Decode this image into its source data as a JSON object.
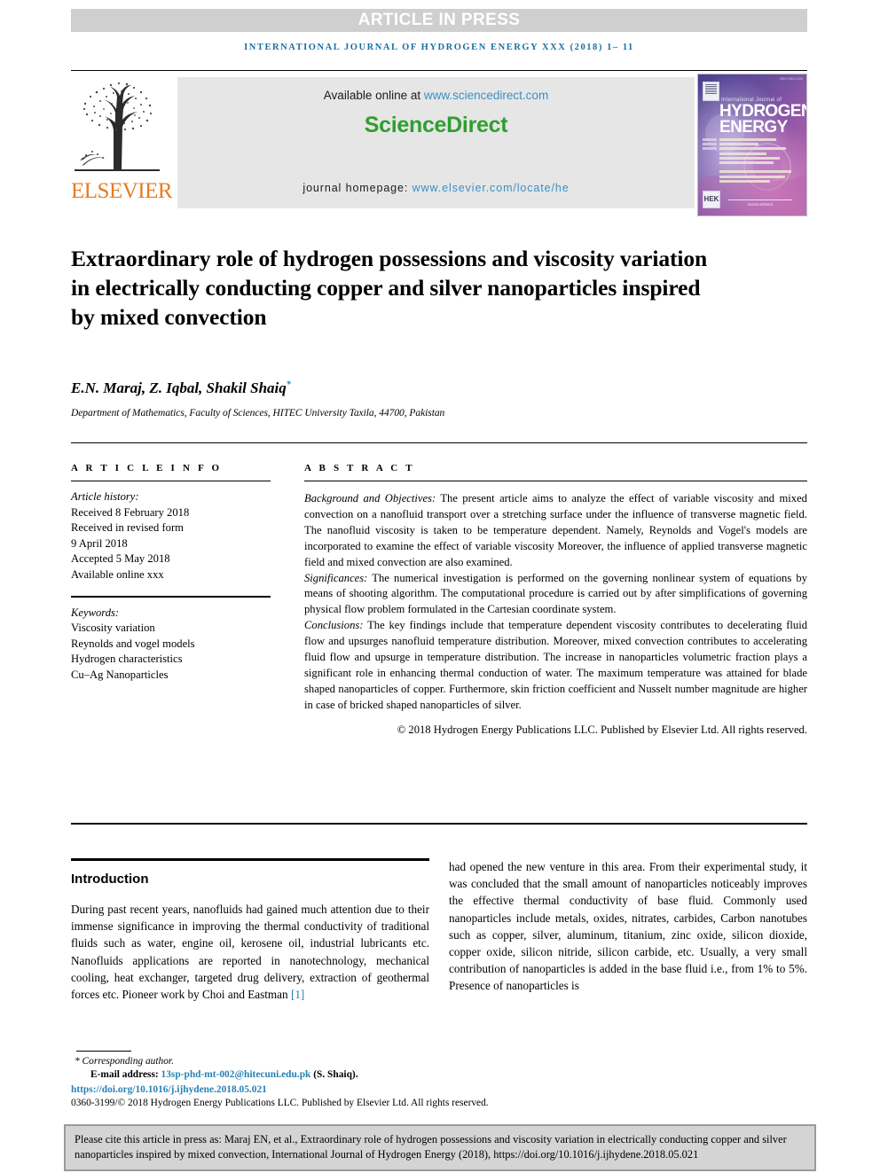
{
  "banner": {
    "text": "ARTICLE IN PRESS"
  },
  "journal_ref": "INTERNATIONAL JOURNAL OF HYDROGEN ENERGY XXX (2018) 1– 11",
  "masthead": {
    "publisher_name": "ELSEVIER",
    "available_prefix": "Available online at ",
    "available_url": "www.sciencedirect.com",
    "brand_sci": "Science",
    "brand_direct": "Direct",
    "homepage_label": "journal homepage: ",
    "homepage_url": "www.elsevier.com/locate/he",
    "cover": {
      "top_label": "ISSN 0360-3199",
      "journal_line": "International Journal of",
      "word_hydrogen": "HYDROGEN",
      "word_energy": "ENERGY",
      "hek_mark": "HEK",
      "science_direct_note": "ScienceDirect"
    }
  },
  "title": "Extraordinary role of hydrogen possessions and viscosity variation in electrically conducting copper and silver nanoparticles inspired by mixed convection",
  "authors": "E.N. Maraj, Z. Iqbal, Shakil Shaiq",
  "author_footnote_marker": "*",
  "affiliation": "Department of Mathematics, Faculty of Sciences, HITEC University Taxila, 44700, Pakistan",
  "article_info": {
    "heading": "A R T I C L E   I N F O",
    "history_label": "Article history:",
    "history": [
      "Received 8 February 2018",
      "Received in revised form",
      "9 April 2018",
      "Accepted 5 May 2018",
      "Available online xxx"
    ],
    "keywords_label": "Keywords:",
    "keywords": [
      "Viscosity variation",
      "Reynolds and vogel models",
      "Hydrogen characteristics",
      "Cu–Ag Nanoparticles"
    ]
  },
  "abstract": {
    "heading": "A B S T R A C T",
    "background_label": "Background and Objectives:",
    "background_text": " The present article aims to analyze the effect of variable viscosity and mixed convection on a nanofluid transport over a stretching surface under the influence of transverse magnetic field. The nanofluid viscosity is taken to be temperature dependent. Namely, Reynolds and Vogel's models are incorporated to examine the effect of variable viscosity Moreover, the influence of applied transverse magnetic field and mixed convection are also examined.",
    "significances_label": "Significances:",
    "significances_text": " The numerical investigation is performed on the governing nonlinear system of equations by means of shooting algorithm. The computational procedure is carried out by after simplifications of governing physical flow problem formulated in the Cartesian coordinate system.",
    "conclusions_label": "Conclusions:",
    "conclusions_text": " The key findings include that temperature dependent viscosity contributes to decelerating fluid flow and upsurges nanofluid temperature distribution. Moreover, mixed convection contributes to accelerating fluid flow and upsurge in temperature distribution. The increase in nanoparticles volumetric fraction plays a significant role in enhancing thermal conduction of water. The maximum temperature was attained for blade shaped nanoparticles of copper. Furthermore, skin friction coefficient and Nusselt number magnitude are higher in case of bricked shaped nanoparticles of silver.",
    "copyright": "© 2018 Hydrogen Energy Publications LLC. Published by Elsevier Ltd. All rights reserved."
  },
  "introduction": {
    "heading": "Introduction",
    "left_paragraph_a": "During past recent years, nanofluids had gained much attention due to their immense significance in improving the thermal conductivity of traditional fluids such as water, engine oil, kerosene oil, industrial lubricants etc. Nanofluids applications are reported in nanotechnology, mechanical cooling, heat exchanger, targeted drug delivery, extraction of geothermal forces etc. Pioneer work by Choi and Eastman ",
    "left_reference": "[1]",
    "right_paragraph": "had opened the new venture in this area. From their experimental study, it was concluded that the small amount of nanoparticles noticeably improves the effective thermal conductivity of base fluid. Commonly used nanoparticles include metals, oxides, nitrates, carbides, Carbon nanotubes such as copper, silver, aluminum, titanium, zinc oxide, silicon dioxide, copper oxide, silicon nitride, silicon carbide, etc. Usually, a very small contribution of nanoparticles is added in the base fluid i.e., from 1% to 5%. Presence of nanoparticles is"
  },
  "footnote": {
    "corresponding_author": "* Corresponding author.",
    "email_label": "E-mail address: ",
    "email_value": "13sp-phd-mt-002@hitecuni.edu.pk",
    "email_suffix": " (S. Shaiq).",
    "doi": "https://doi.org/10.1016/j.ijhydene.2018.05.021",
    "issn_line": "0360-3199/© 2018 Hydrogen Energy Publications LLC. Published by Elsevier Ltd. All rights reserved."
  },
  "cite_box": {
    "text": "Please cite this article in press as: Maraj EN, et al., Extraordinary role of hydrogen possessions and viscosity variation in electrically conducting copper and silver nanoparticles inspired by mixed convection, International Journal of Hydrogen Energy (2018), https://doi.org/10.1016/j.ijhydene.2018.05.021"
  },
  "colors": {
    "banner_bg": "#cfcfcf",
    "banner_text": "#ffffff",
    "journal_ref": "#1a6fa3",
    "link": "#2782b5",
    "sciencedirect_green": "#2f9e2f",
    "elsevier_orange": "#e77b22",
    "cite_box_bg": "#d4d4d4"
  }
}
